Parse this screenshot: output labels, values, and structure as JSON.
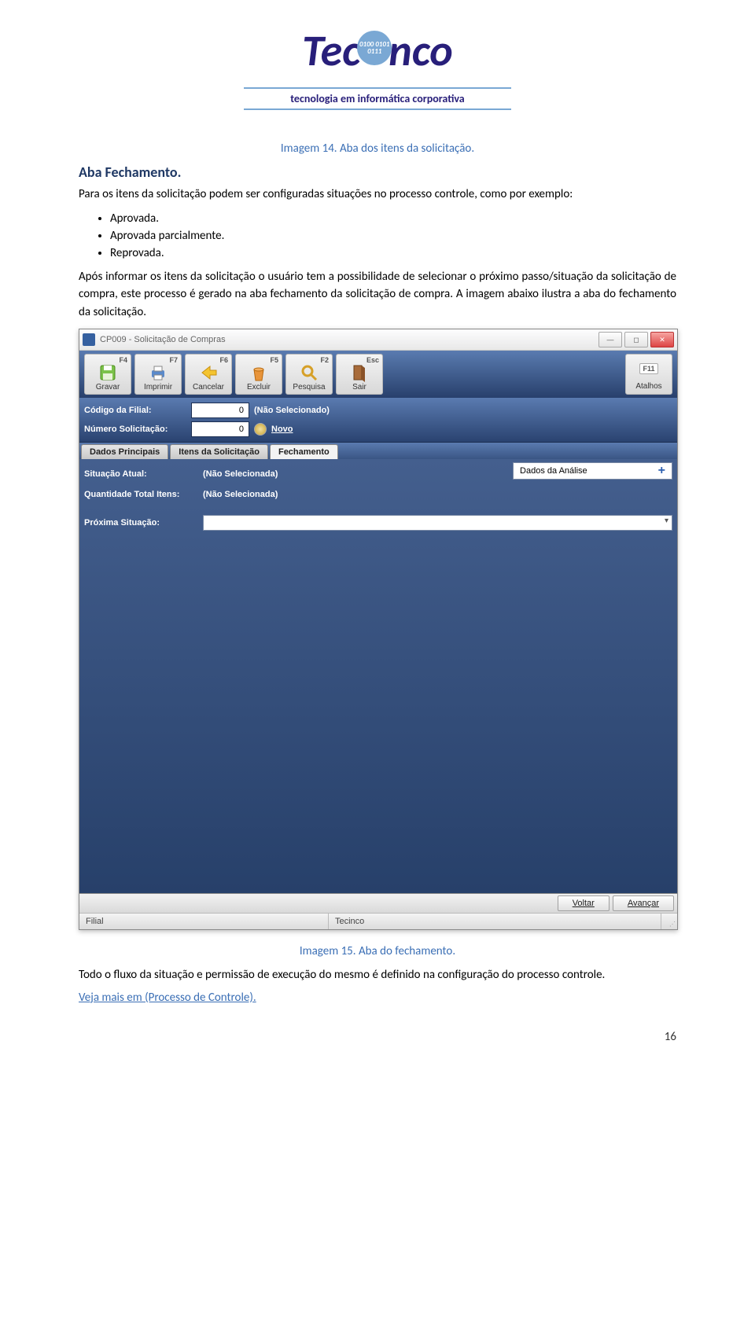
{
  "logo": {
    "brand_left": "Tec",
    "brand_right": "nco",
    "dot_text": "0100\n0101\n0111",
    "tagline": "tecnologia em informática corporativa"
  },
  "caption_top": "Imagem 14. Aba dos itens da solicitação.",
  "heading": "Aba Fechamento.",
  "para1": "Para os itens da solicitação podem ser configuradas situações no processo controle, como por exemplo:",
  "bullets": [
    "Aprovada.",
    "Aprovada parcialmente.",
    "Reprovada."
  ],
  "para2": "Após informar os itens da solicitação o usuário tem a possibilidade de selecionar o próximo passo/situação da solicitação de compra, este processo é gerado na aba fechamento da solicitação de compra. A imagem abaixo ilustra a aba do fechamento da solicitação.",
  "app": {
    "title": "CP009 - Solicitação de Compras",
    "toolbar": [
      {
        "key": "F4",
        "label": "Gravar"
      },
      {
        "key": "F7",
        "label": "Imprimir"
      },
      {
        "key": "F6",
        "label": "Cancelar"
      },
      {
        "key": "F5",
        "label": "Excluir"
      },
      {
        "key": "F2",
        "label": "Pesquisa"
      },
      {
        "key": "Esc",
        "label": "Sair"
      }
    ],
    "toolbar_right": {
      "key": "F11",
      "label": "Atalhos"
    },
    "header": {
      "filial_label": "Código da Filial:",
      "filial_value": "0",
      "filial_name": "(Não Selecionado)",
      "num_label": "Número Solicitação:",
      "num_value": "0",
      "novo_label": "Novo"
    },
    "tabs": [
      "Dados Principais",
      "Itens da Solicitação",
      "Fechamento"
    ],
    "active_tab": "Fechamento",
    "form": {
      "situacao_label": "Situação Atual:",
      "situacao_value": "(Não Selecionada)",
      "analysis_label": "Dados da Análise",
      "qtd_label": "Quantidade Total Itens:",
      "qtd_value": "(Não Selecionada)",
      "proxima_label": "Próxima Situação:"
    },
    "footer": {
      "voltar": "Voltar",
      "avancar": "Avançar"
    },
    "status": {
      "left": "Filial",
      "mid": "Tecinco"
    }
  },
  "caption_bottom": "Imagem 15. Aba do fechamento.",
  "para3": "Todo o fluxo da situação e permissão de execução do mesmo é definido na configuração do processo controle.",
  "link": "Veja mais em (Processo de Controle).",
  "page_number": "16"
}
